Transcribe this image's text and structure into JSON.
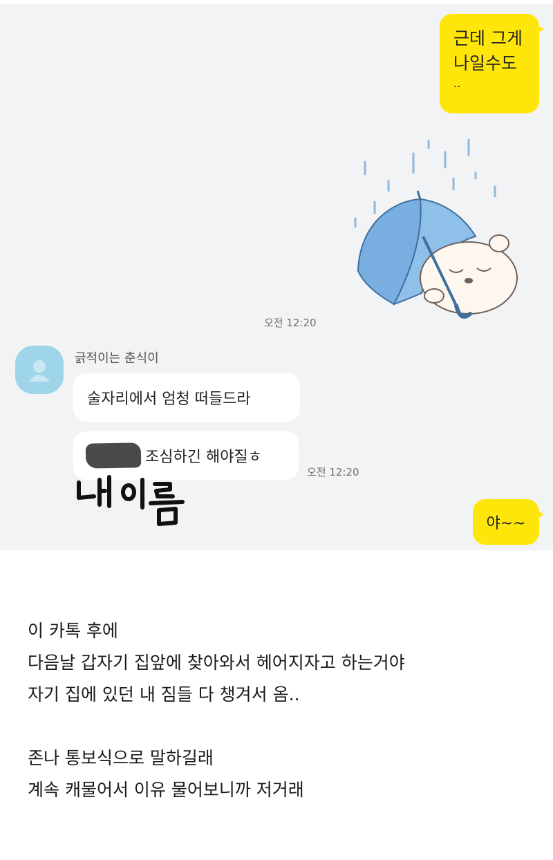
{
  "chat": {
    "messages_me": [
      {
        "lines": [
          "근데 그게",
          "나일수도"
        ],
        "trail": ".."
      },
      {
        "text": "야~~"
      }
    ],
    "time_1": "오전 12:20",
    "time_2": "오전 12:20",
    "sender_name": "긁적이는 춘식이",
    "messages_other": [
      {
        "text": "술자리에서 엄청 떠들드라"
      },
      {
        "text": "조심하긴 해야질ㅎ"
      }
    ],
    "handwritten_note": "내 이름",
    "sticker": "umbrella-character-sticker",
    "colors": {
      "chat_background": "#f2f3f5",
      "my_bubble": "#ffe60a",
      "other_bubble": "#ffffff",
      "avatar": "#9fd5e8",
      "umbrella": "#78aee0"
    }
  },
  "post": {
    "lines": [
      "이 카톡 후에",
      "다음날 갑자기 집앞에 찾아와서 헤어지자고 하는거야",
      "자기 집에 있던 내 짐들 다 챙겨서 옴..",
      "존나 통보식으로 말하길래",
      "계속 캐물어서 이유 물어보니까 저거래"
    ]
  }
}
